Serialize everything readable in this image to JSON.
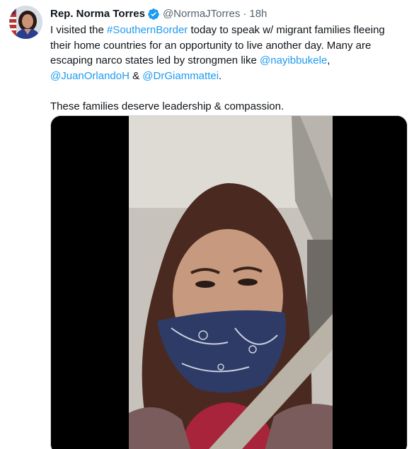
{
  "author": {
    "display_name": "Rep. Norma Torres",
    "handle": "@NormaJTorres",
    "separator": "·",
    "timestamp": "18h",
    "verified_icon": "verified-badge-icon",
    "avatar_icon": "profile-photo"
  },
  "tweet": {
    "line1": {
      "t1": "I visited the ",
      "hashtag": "#SouthernBorder",
      "t2": " today to speak w/ migrant families fleeing their home countries for an opportunity to live another day. Many are escaping narco states led by strongmen like ",
      "mention1": "@nayibbukele",
      "t3": ", ",
      "mention2": "@JuanOrlandoH",
      "t4": " & ",
      "mention3": "@DrGiammattei",
      "t5": "."
    },
    "line2": "These families deserve leadership & compassion."
  },
  "media": {
    "type": "video",
    "description_icon": "video-thumbnail"
  },
  "colors": {
    "link": "#1d9bf0",
    "verified": "#1d9bf0",
    "secondary_text": "#536471"
  }
}
